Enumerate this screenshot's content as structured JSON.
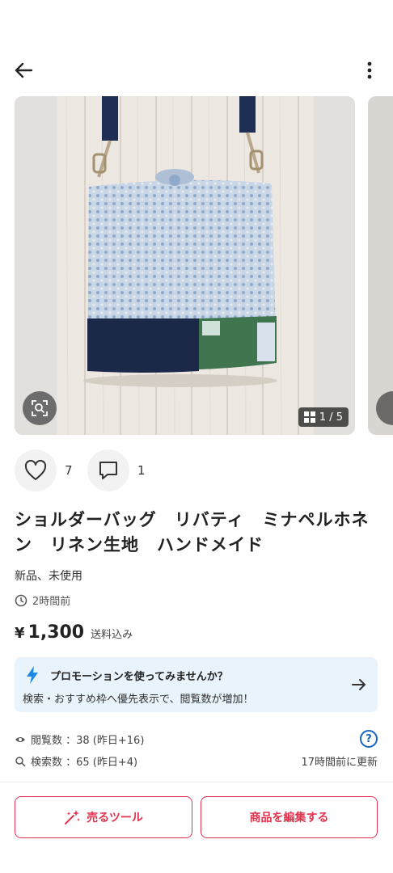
{
  "header": {
    "back_icon": "arrow-left-icon",
    "menu_icon": "more-vertical-icon"
  },
  "gallery": {
    "counter_text": "1 / 5",
    "zoom_icon": "image-search-icon"
  },
  "actions": {
    "like_count": "7",
    "comment_count": "1"
  },
  "item": {
    "title": "ショルダーバッグ　リバティ　ミナペルホネン　リネン生地　ハンドメイド",
    "condition": "新品、未使用",
    "posted": "2時間前",
    "price_symbol": "¥",
    "price": "1,300",
    "shipping": "送料込み"
  },
  "promo": {
    "title": "プロモーションを使ってみませんか？",
    "subtitle": "検索・おすすめ枠へ優先表示で、閲覧数が増加！"
  },
  "stats": {
    "views": "閲覧数 ：38 (昨日+16)",
    "searches": "検索数 ：65 (昨日+4)",
    "updated": "17時間前に更新",
    "help": "?"
  },
  "buttons": {
    "sell_tool": "売るツール",
    "edit_item": "商品を編集する"
  },
  "colors": {
    "accent": "#e3324d",
    "promo_bg": "#e9f3fc",
    "bolt": "#1e88e5",
    "help": "#1565c0"
  }
}
